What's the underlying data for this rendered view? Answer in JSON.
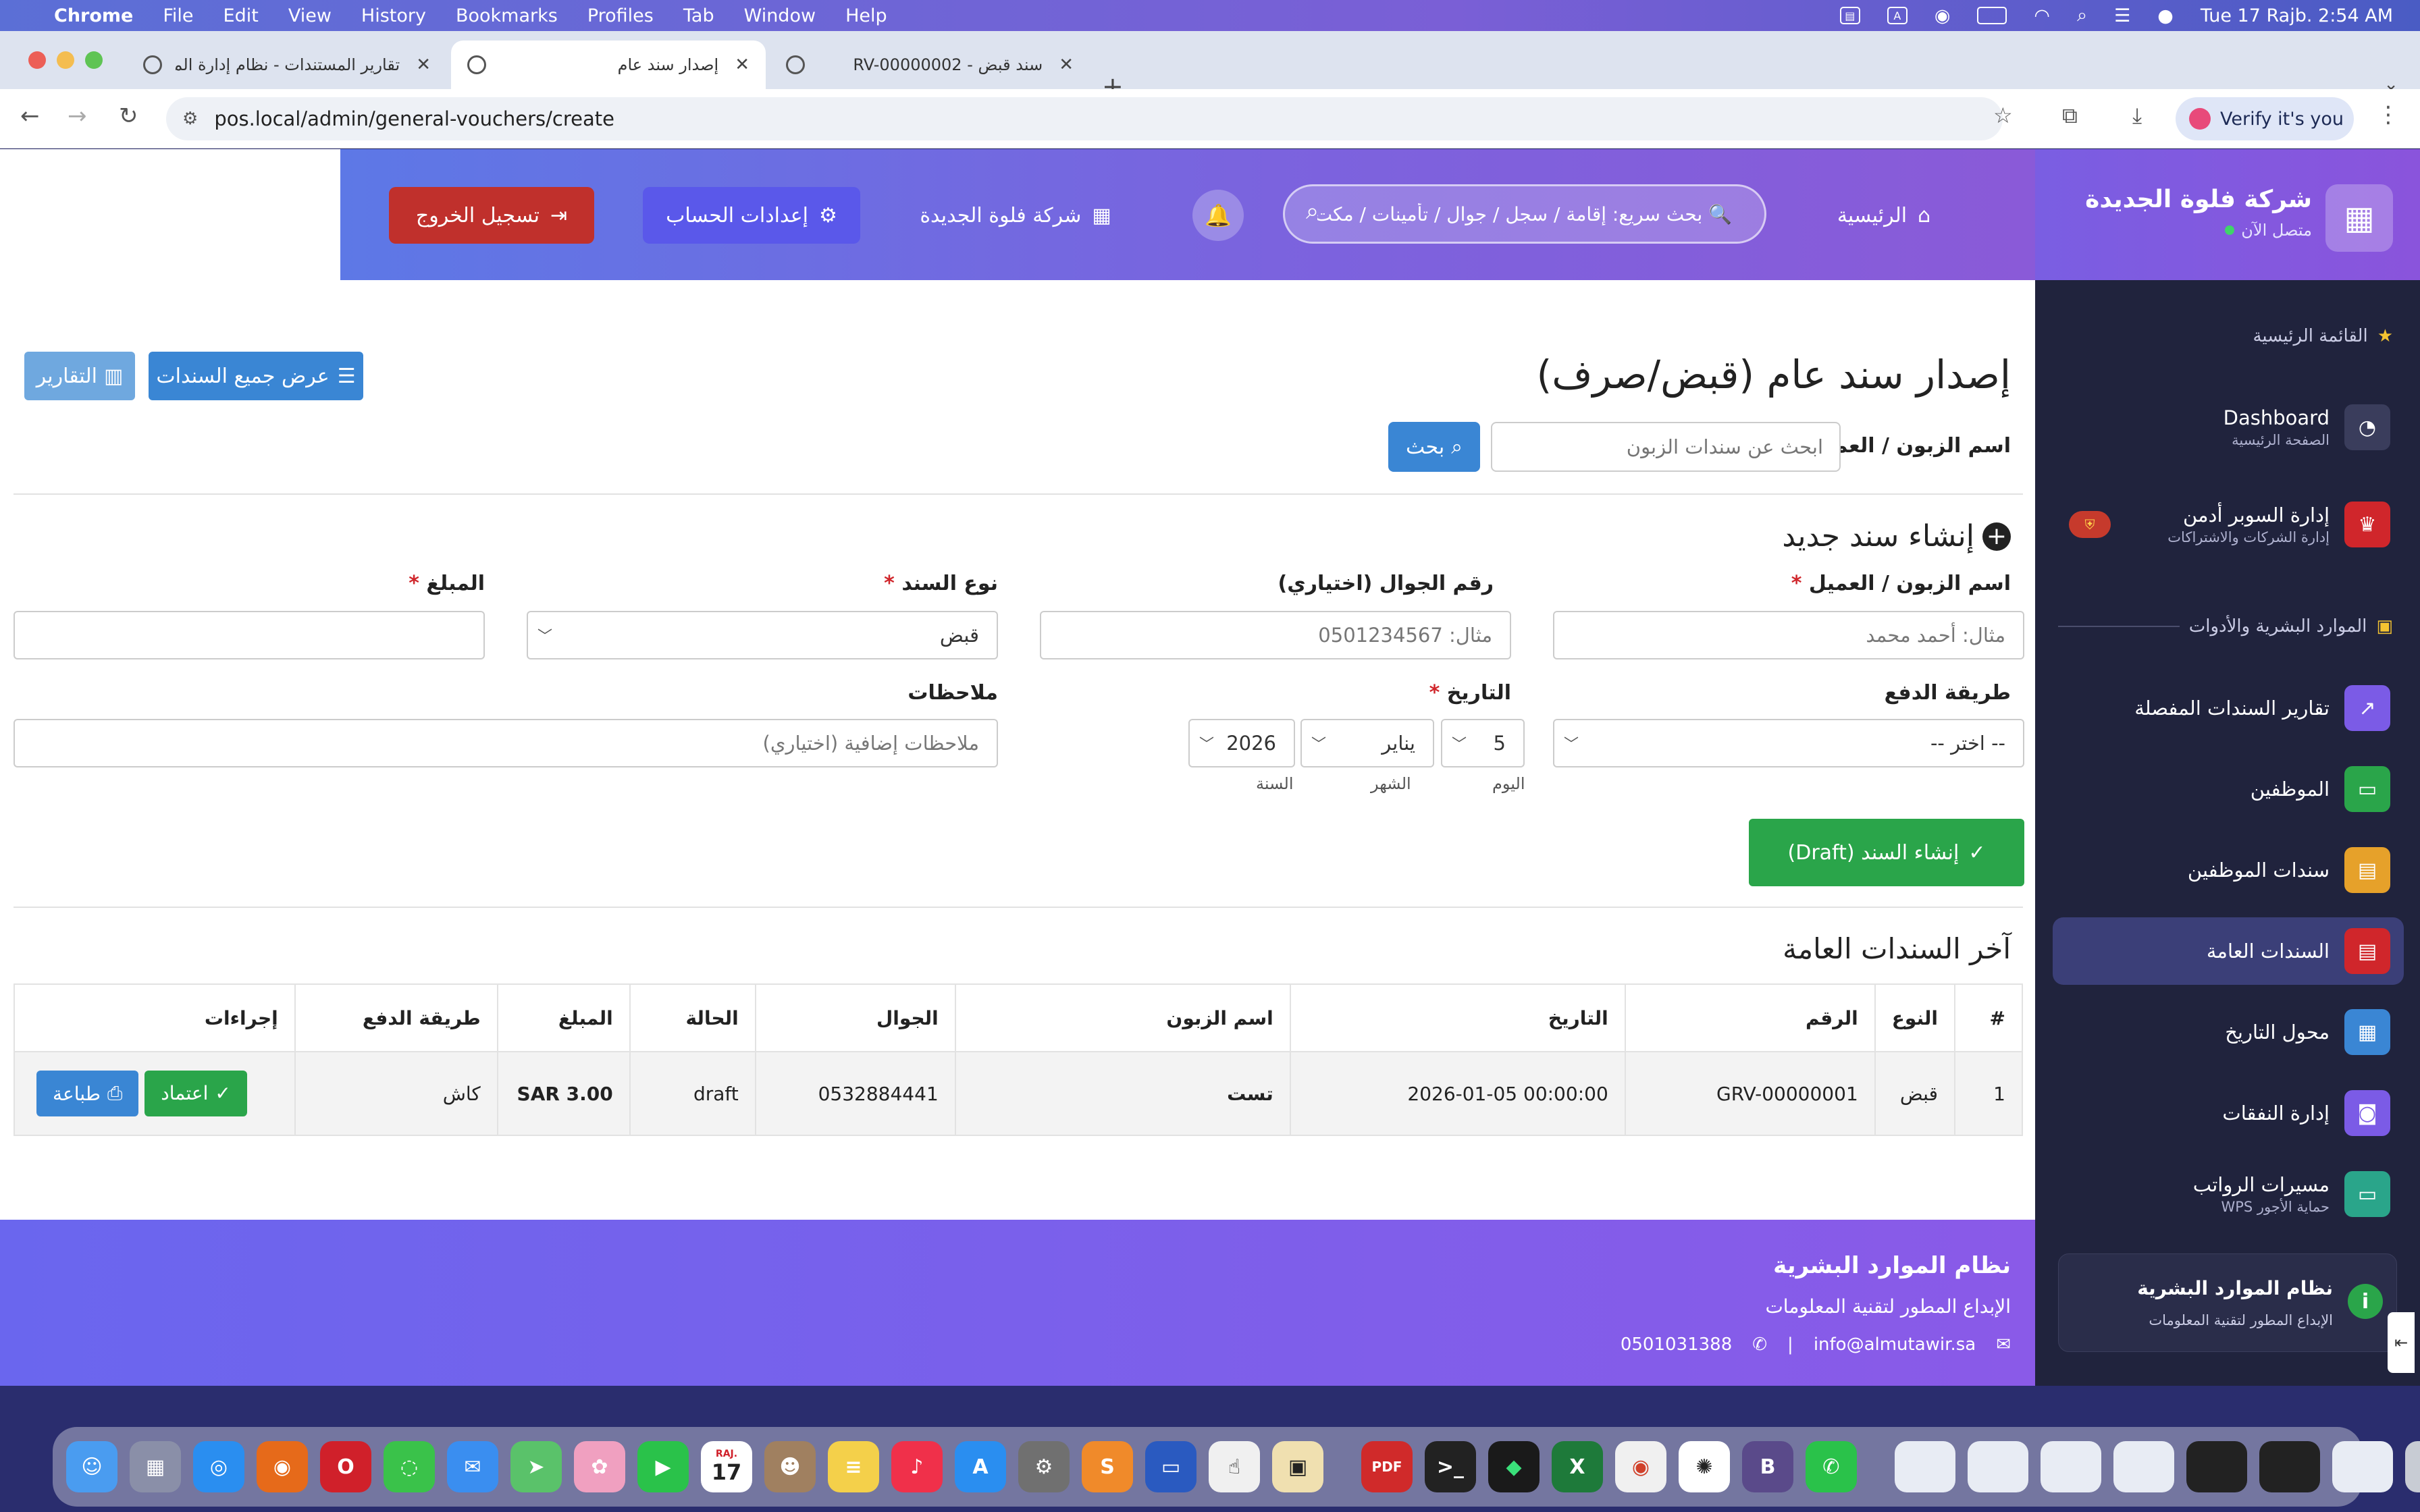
{
  "menubar": {
    "app": "Chrome",
    "items": [
      "File",
      "Edit",
      "View",
      "History",
      "Bookmarks",
      "Profiles",
      "Tab",
      "Window",
      "Help"
    ],
    "clock": "Tue 17 Rajb.  2:54 AM"
  },
  "tabs": [
    {
      "label": "تقارير المستندات - نظام إدارة الموا",
      "active": false
    },
    {
      "label": "إصدار سند عام",
      "active": true
    },
    {
      "label": "سند قبض - RV-00000002",
      "active": false
    }
  ],
  "toolbar": {
    "url": "pos.local/admin/general-vouchers/create",
    "verify_label": "Verify it's you"
  },
  "header": {
    "logout_label": "تسجيل الخروج",
    "account_label": "إعدادات الحساب",
    "company_label": "شركة فلوة الجديدة",
    "search_placeholder": "🔍 بحث سريع: إقامة / سجل / جوال / تأمينات / مكت",
    "home_label": "الرئيسية"
  },
  "main": {
    "title": "إصدار سند عام (قبض/صرف)",
    "all_vouchers_label": "عرض جميع السندات",
    "reports_label": "التقارير",
    "customer_search_label": "اسم الزبون / العميل",
    "customer_search_placeholder": "ابحث عن سندات الزبون",
    "search_button_label": "بحث"
  },
  "form": {
    "title": "إنشاء سند جديد",
    "customer_label": "اسم الزبون / العميل",
    "customer_placeholder": "مثال: أحمد محمد",
    "phone_label": "رقم الجوال (اختياري)",
    "phone_placeholder": "مثال: 0501234567",
    "type_label": "نوع السند",
    "type_value": "قبض",
    "amount_label": "المبلغ",
    "amount_value": "",
    "payment_label": "طريقة الدفع",
    "payment_value": "-- اختر --",
    "date_label": "التاريخ",
    "day_value": "5",
    "month_value": "يناير",
    "year_value": "2026",
    "day_caption": "اليوم",
    "month_caption": "الشهر",
    "year_caption": "السنة",
    "notes_label": "ملاحظات",
    "notes_placeholder": "ملاحظات إضافية (اختياري)",
    "required_mark": "*",
    "submit_label": "إنشاء السند (Draft)"
  },
  "table": {
    "title": "آخر السندات العامة",
    "columns": [
      "#",
      "النوع",
      "الرقم",
      "التاريخ",
      "اسم الزبون",
      "الجوال",
      "الحالة",
      "المبلغ",
      "طريقة الدفع",
      "إجراءات"
    ],
    "rows": [
      {
        "index": "1",
        "type": "قبض",
        "number": "GRV-00000001",
        "date": "2026-01-05 00:00:00",
        "customer": "تست",
        "phone": "0532884441",
        "status": "draft",
        "amount": "SAR 3.00",
        "payment": "كاش",
        "print_label": "طباعة",
        "approve_label": "اعتماد"
      }
    ]
  },
  "footer": {
    "title": "نظام الموارد البشرية",
    "subtitle": "الإبداع المطور لتقنية المعلومات",
    "email": "info@almutawir.sa",
    "phone": "0501031388",
    "separator": "|"
  },
  "sidebar": {
    "company": "شركة فلوة الجديدة",
    "status": "متصل الآن",
    "section_main": "القائمة الرئيسية",
    "section_hr": "الموارد البشرية والأدوات",
    "items": [
      {
        "label": "Dashboard",
        "sub": "الصفحة الرئيسية",
        "icon": "gauge-icon",
        "color": "#3a3d5c"
      },
      {
        "label": "إدارة السوبر أدمن",
        "sub": "إدارة الشركات والاشتراكات",
        "icon": "crown-icon",
        "color": "#d0262b"
      },
      {
        "label": "تقارير السندات المفصلة",
        "icon": "chart-line-icon",
        "color": "#7b5be6"
      },
      {
        "label": "الموظفين",
        "icon": "id-card-icon",
        "color": "#2aa54a"
      },
      {
        "label": "سندات الموظفين",
        "icon": "file-icon",
        "color": "#e6a12a"
      },
      {
        "label": "السندات العامة",
        "icon": "file-invoice-icon",
        "color": "#d0262b"
      },
      {
        "label": "محول التاريخ",
        "icon": "calendar-icon",
        "color": "#3a86d4"
      },
      {
        "label": "إدارة النفقات",
        "icon": "money-icon",
        "color": "#7b5be6"
      },
      {
        "label": "مسيرات الرواتب",
        "sub": "حماية الأجور WPS",
        "icon": "wallet-icon",
        "color": "#2aa58a"
      }
    ],
    "footer_title": "نظام الموارد البشرية",
    "footer_sub": "الإبداع المطور لتقنية المعلومات"
  },
  "dock": {
    "calendar_month": "RAJ.",
    "calendar_day": "17",
    "pdf_label": "PDF"
  }
}
